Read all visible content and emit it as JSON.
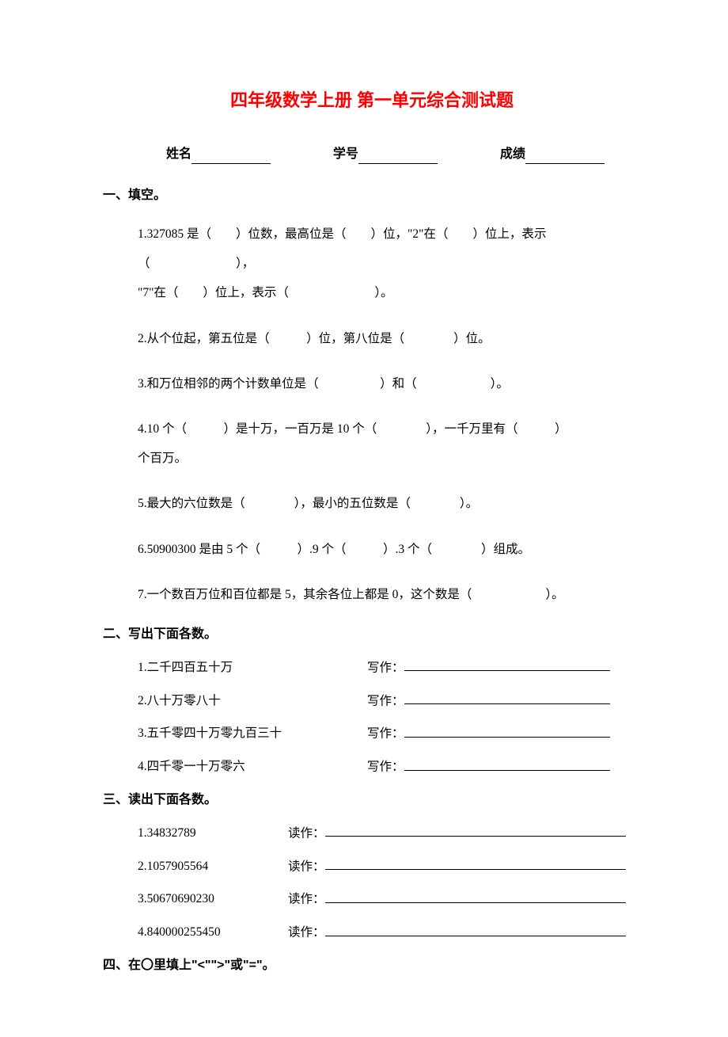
{
  "title": "四年级数学上册 第一单元综合测试题",
  "info": {
    "name_label": "姓名",
    "id_label": "学号",
    "score_label": "成绩"
  },
  "sections": {
    "s1": {
      "heading": "一、填空。",
      "q1a": "1.327085 是（　　）位数，最高位是（　　）位，\"2\"在（　　）位上，表示",
      "q1b": "（　　　　　　　），",
      "q1c": "\"7\"在（　　）位上，表示（　　　　　　　）。",
      "q2": "2.从个位起，第五位是（　　　）位，第八位是（　　　　）位。",
      "q3": "3.和万位相邻的两个计数单位是（　　　　　）和（　　　　　　）。",
      "q4a": "4.10 个（　　　）是十万，一百万是 10 个（　　　　），一千万里有（　　　）",
      "q4b": "个百万。",
      "q5": "5.最大的六位数是（　　　　），最小的五位数是（　　　　）。",
      "q6": "6.50900300 是由 5 个（　　　）.9 个（　　　）.3 个（　　　　）组成。",
      "q7": "7.一个数百万位和百位都是 5，其余各位上都是 0，这个数是（　　　　　　）。"
    },
    "s2": {
      "heading": "二、写出下面各数。",
      "items": [
        {
          "label": "1.二千四百五十万",
          "answer": "写作："
        },
        {
          "label": "2.八十万零八十",
          "answer": "写作："
        },
        {
          "label": "3.五千零四十万零九百三十",
          "answer": "写作："
        },
        {
          "label": "4.四千零一十万零六",
          "answer": "写作："
        }
      ]
    },
    "s3": {
      "heading": "三、读出下面各数。",
      "items": [
        {
          "label": "1.34832789",
          "answer": "读作："
        },
        {
          "label": "2.1057905564",
          "answer": "读作："
        },
        {
          "label": "3.50670690230",
          "answer": "读作："
        },
        {
          "label": "4.840000255450",
          "answer": "读作："
        }
      ]
    },
    "s4": {
      "heading": "四、在〇里填上\"<\"\">\"或\"=\"。"
    }
  }
}
